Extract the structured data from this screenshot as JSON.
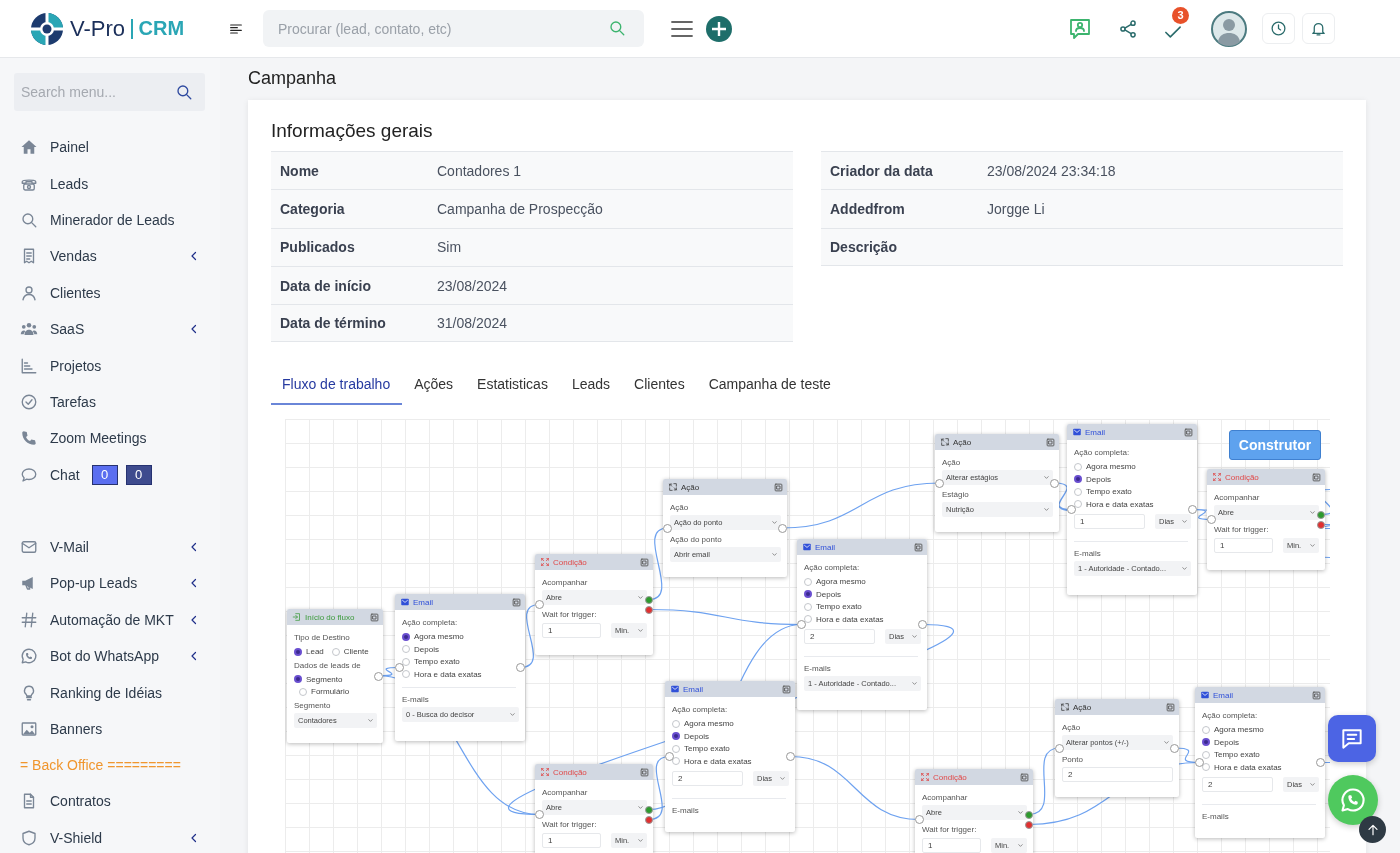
{
  "header": {
    "logo": {
      "brand": "V-Pro",
      "product": "CRM"
    },
    "search": {
      "placeholder": "Procurar (lead, contato, etc)"
    },
    "tasks_badge": "3"
  },
  "sidebar": {
    "search": {
      "placeholder": "Search menu..."
    },
    "sections": [
      {
        "items": [
          {
            "kind": "link",
            "label": "Painel",
            "expandable": false
          },
          {
            "kind": "link",
            "label": "Leads",
            "expandable": false
          },
          {
            "kind": "link",
            "label": "Minerador de Leads",
            "expandable": false
          },
          {
            "kind": "link",
            "label": "Vendas",
            "expandable": true
          },
          {
            "kind": "link",
            "label": "Clientes",
            "expandable": false
          },
          {
            "kind": "link",
            "label": "SaaS",
            "expandable": true
          },
          {
            "kind": "link",
            "label": "Projetos",
            "expandable": false
          },
          {
            "kind": "link",
            "label": "Tarefas",
            "expandable": false
          },
          {
            "kind": "link",
            "label": "Zoom Meetings",
            "expandable": false
          },
          {
            "kind": "link",
            "label": "Chat",
            "expandable": false,
            "badges": [
              "0",
              "0"
            ]
          }
        ]
      },
      {
        "items": [
          {
            "kind": "link",
            "label": "V-Mail",
            "expandable": true
          },
          {
            "kind": "link",
            "label": "Pop-up Leads",
            "expandable": true
          },
          {
            "kind": "link",
            "label": "Automação de MKT",
            "expandable": true
          },
          {
            "kind": "link",
            "label": "Bot do WhatsApp",
            "expandable": true
          },
          {
            "kind": "link",
            "label": "Ranking de Idéias",
            "expandable": false
          },
          {
            "kind": "link",
            "label": "Banners",
            "expandable": false
          },
          {
            "kind": "heading",
            "label": "= Back Office ========="
          },
          {
            "kind": "link",
            "label": "Contratos",
            "expandable": false
          },
          {
            "kind": "link",
            "label": "V-Shield",
            "expandable": true
          }
        ]
      }
    ]
  },
  "page_title": "Campanha",
  "general": {
    "title": "Informações gerais",
    "left": [
      {
        "label": "Nome",
        "value": "Contadores 1"
      },
      {
        "label": "Categoria",
        "value": "Campanha de Prospecção"
      },
      {
        "label": "Publicados",
        "value": "Sim"
      },
      {
        "label": "Data de início",
        "value": "23/08/2024"
      },
      {
        "label": "Data de término",
        "value": "31/08/2024"
      }
    ],
    "right": [
      {
        "label": "Criador da data",
        "value": "23/08/2024 23:34:18"
      },
      {
        "label": "Addedfrom",
        "value": "Jorgge Li"
      },
      {
        "label": "Descrição"
      }
    ]
  },
  "tabs": [
    {
      "label": "Fluxo de trabalho",
      "selected": true
    },
    {
      "label": "Ações",
      "selected": false
    },
    {
      "label": "Estatisticas",
      "selected": false
    },
    {
      "label": "Leads",
      "selected": false
    },
    {
      "label": "Clientes",
      "selected": false
    },
    {
      "label": "Campanha de teste",
      "selected": false
    }
  ],
  "workflow": {
    "builder_button": "Construtor",
    "nodes": [
      {
        "kind": "start",
        "title": "Início do fluxo",
        "fields": [
          {
            "kind": "label",
            "text": "Tipo de Destino"
          },
          {
            "kind": "radio_row",
            "options": [
              {
                "label": "Lead",
                "selected": true
              },
              {
                "label": "Cliente",
                "selected": false
              }
            ]
          },
          {
            "kind": "label",
            "text": "Dados de leads de"
          },
          {
            "kind": "radios",
            "options": [
              {
                "label": "Segmento",
                "selected": true
              },
              {
                "label": "Formulário",
                "selected": false
              }
            ]
          },
          {
            "kind": "label",
            "text": "Segmento"
          },
          {
            "kind": "select",
            "value": "Contadores"
          }
        ]
      },
      {
        "kind": "email",
        "title": "Email",
        "fields": [
          {
            "kind": "label",
            "text": "Ação completa:"
          },
          {
            "kind": "radios",
            "options": [
              {
                "label": "Agora mesmo",
                "selected": true
              },
              {
                "label": "Depois",
                "selected": false
              },
              {
                "label": "Tempo exato",
                "selected": false
              },
              {
                "label": "Hora e data exatas",
                "selected": false
              }
            ]
          },
          {
            "kind": "rule"
          },
          {
            "kind": "label",
            "text": "E-mails"
          },
          {
            "kind": "select",
            "value": "0 - Busca do decisor"
          }
        ]
      },
      {
        "kind": "condition",
        "title": "Condição",
        "fields": [
          {
            "kind": "label",
            "text": "Acompanhar"
          },
          {
            "kind": "select",
            "value": "Abre"
          },
          {
            "kind": "label",
            "text": "Wait for trigger:"
          },
          {
            "kind": "input_select",
            "value": "1",
            "unit": "Min."
          }
        ]
      },
      {
        "kind": "action",
        "title": "Ação",
        "fields": [
          {
            "kind": "label",
            "text": "Ação"
          },
          {
            "kind": "select",
            "value": "Ação do ponto"
          },
          {
            "kind": "label",
            "text": "Ação do ponto"
          },
          {
            "kind": "select",
            "value": "Abrir email"
          }
        ]
      },
      {
        "kind": "email",
        "title": "Email",
        "fields": [
          {
            "kind": "label",
            "text": "Ação completa:"
          },
          {
            "kind": "radios",
            "options": [
              {
                "label": "Agora mesmo",
                "selected": false
              },
              {
                "label": "Depois",
                "selected": true
              },
              {
                "label": "Tempo exato",
                "selected": false
              },
              {
                "label": "Hora e data exatas",
                "selected": false
              }
            ]
          },
          {
            "kind": "input_select",
            "value": "2",
            "unit": "Dias"
          },
          {
            "kind": "rule"
          },
          {
            "kind": "label",
            "text": "E-mails"
          },
          {
            "kind": "select",
            "value": "1 - Autoridade - Contado..."
          }
        ]
      },
      {
        "kind": "action",
        "title": "Ação",
        "fields": [
          {
            "kind": "label",
            "text": "Ação"
          },
          {
            "kind": "select",
            "value": "Alterar estágios"
          },
          {
            "kind": "label",
            "text": "Estágio"
          },
          {
            "kind": "select",
            "value": "Nutrição"
          }
        ]
      },
      {
        "kind": "email",
        "title": "Email",
        "fields": [
          {
            "kind": "label",
            "text": "Ação completa:"
          },
          {
            "kind": "radios",
            "options": [
              {
                "label": "Agora mesmo",
                "selected": false
              },
              {
                "label": "Depois",
                "selected": true
              },
              {
                "label": "Tempo exato",
                "selected": false
              },
              {
                "label": "Hora e data exatas",
                "selected": false
              }
            ]
          },
          {
            "kind": "input_select",
            "value": "1",
            "unit": "Dias"
          },
          {
            "kind": "rule"
          },
          {
            "kind": "label",
            "text": "E-mails"
          },
          {
            "kind": "select",
            "value": "1 - Autoridade - Contado..."
          }
        ]
      },
      {
        "kind": "condition",
        "title": "Condição",
        "fields": [
          {
            "kind": "label",
            "text": "Acompanhar"
          },
          {
            "kind": "select",
            "value": "Abre"
          },
          {
            "kind": "label",
            "text": "Wait for trigger:"
          },
          {
            "kind": "input_select",
            "value": "1",
            "unit": "Min."
          }
        ]
      },
      {
        "kind": "condition",
        "title": "Condição",
        "fields": [
          {
            "kind": "label",
            "text": "Acompanhar"
          },
          {
            "kind": "select",
            "value": "Abre"
          },
          {
            "kind": "label",
            "text": "Wait for trigger:"
          },
          {
            "kind": "input_select",
            "value": "1",
            "unit": "Min."
          }
        ]
      },
      {
        "kind": "email",
        "title": "Email",
        "fields": [
          {
            "kind": "label",
            "text": "Ação completa:"
          },
          {
            "kind": "radios",
            "options": [
              {
                "label": "Agora mesmo",
                "selected": false
              },
              {
                "label": "Depois",
                "selected": true
              },
              {
                "label": "Tempo exato",
                "selected": false
              },
              {
                "label": "Hora e data exatas",
                "selected": false
              }
            ]
          },
          {
            "kind": "input_select",
            "value": "2",
            "unit": "Dias"
          },
          {
            "kind": "rule"
          },
          {
            "kind": "label",
            "text": "E-mails"
          }
        ]
      },
      {
        "kind": "condition",
        "title": "Condição",
        "fields": [
          {
            "kind": "label",
            "text": "Acompanhar"
          },
          {
            "kind": "select",
            "value": "Abre"
          },
          {
            "kind": "label",
            "text": "Wait for trigger:"
          },
          {
            "kind": "input_select",
            "value": "1",
            "unit": "Min."
          }
        ]
      },
      {
        "kind": "action",
        "title": "Ação",
        "fields": [
          {
            "kind": "label",
            "text": "Ação"
          },
          {
            "kind": "select",
            "value": "Alterar pontos (+/-)"
          },
          {
            "kind": "label",
            "text": "Ponto"
          },
          {
            "kind": "input",
            "value": "2"
          }
        ]
      },
      {
        "kind": "email",
        "title": "Email",
        "fields": [
          {
            "kind": "label",
            "text": "Ação completa:"
          },
          {
            "kind": "radios",
            "options": [
              {
                "label": "Agora mesmo",
                "selected": false
              },
              {
                "label": "Depois",
                "selected": true
              },
              {
                "label": "Tempo exato",
                "selected": false
              },
              {
                "label": "Hora e data exatas",
                "selected": false
              }
            ]
          },
          {
            "kind": "input_select",
            "value": "2",
            "unit": "Dias"
          },
          {
            "kind": "rule"
          },
          {
            "kind": "label",
            "text": "E-mails"
          }
        ]
      }
    ]
  }
}
